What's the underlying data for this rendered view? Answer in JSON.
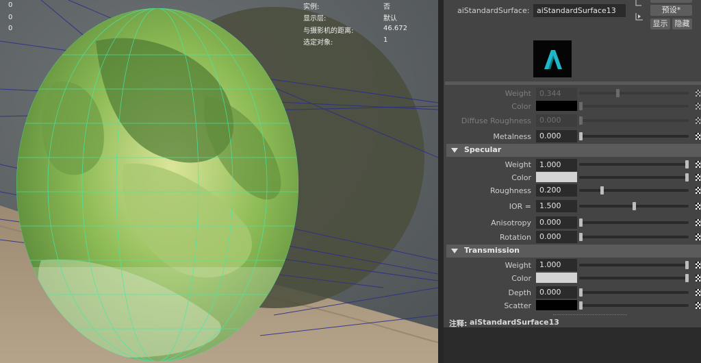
{
  "hud": {
    "counts": [
      "0",
      "0",
      "0"
    ],
    "labels": [
      "实例:",
      "显示层:",
      "与摄影机的距离:",
      "选定对象:"
    ],
    "values": [
      "否",
      "默认",
      "46.672",
      "1"
    ]
  },
  "header": {
    "surface_label": "aiStandardSurface:",
    "surface_name": "aiStandardSurface13",
    "preset_button": "预设*",
    "show_button": "显示",
    "hide_button": "隐藏",
    "logo_icon": "arnold-logo-icon"
  },
  "base": {
    "weight_label": "Weight",
    "weight_value": "0.344",
    "color_label": "Color",
    "color_value": "#000000",
    "diffuse_roughness_label": "Diffuse Roughness",
    "diffuse_roughness_value": "0.000",
    "metalness_label": "Metalness",
    "metalness_value": "0.000"
  },
  "specular": {
    "title": "Specular",
    "weight_label": "Weight",
    "weight_value": "1.000",
    "color_label": "Color",
    "color_value": "#d4d4d4",
    "roughness_label": "Roughness",
    "roughness_value": "0.200",
    "ior_label": "IOR =",
    "ior_value": "1.500",
    "anisotropy_label": "Anisotropy",
    "anisotropy_value": "0.000",
    "rotation_label": "Rotation",
    "rotation_value": "0.000"
  },
  "transmission": {
    "title": "Transmission",
    "weight_label": "Weight",
    "weight_value": "1.000",
    "color_label": "Color",
    "color_value": "#d4d4d4",
    "depth_label": "Depth",
    "depth_value": "0.000",
    "scatter_label": "Scatter",
    "scatter_value": "#000000"
  },
  "notes": {
    "label": "注释:",
    "value": "aiStandardSurface13"
  },
  "colors": {
    "accent_logo": "#1fb8c8",
    "panel_bg": "#444444",
    "field_bg": "#2b2b2b"
  }
}
